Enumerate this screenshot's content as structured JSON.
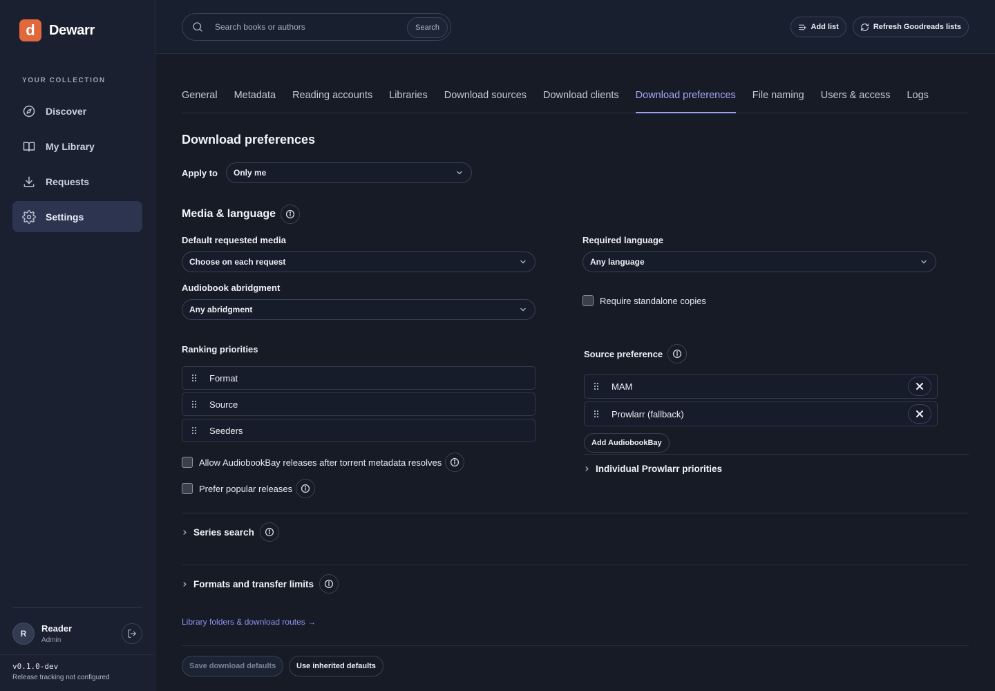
{
  "app": {
    "logo_letter": "d",
    "name": "Dewarr",
    "accent": "#a6a9f5",
    "brand": "#e0683a"
  },
  "sidebar": {
    "section_label": "YOUR COLLECTION",
    "items": [
      {
        "label": "Discover",
        "icon": "compass-icon"
      },
      {
        "label": "My Library",
        "icon": "book-icon"
      },
      {
        "label": "Requests",
        "icon": "download-icon"
      },
      {
        "label": "Settings",
        "icon": "gear-icon",
        "active": true
      }
    ],
    "user": {
      "initial": "R",
      "name": "Reader",
      "role": "Admin"
    },
    "version": "v0.1.0-dev",
    "release_status": "Release tracking not configured"
  },
  "topbar": {
    "search_placeholder": "Search books or authors",
    "search_button": "Search",
    "add_list": "Add list",
    "refresh": "Refresh Goodreads lists"
  },
  "tabs": [
    "General",
    "Metadata",
    "Reading accounts",
    "Libraries",
    "Download sources",
    "Download clients",
    "Download preferences",
    "File naming",
    "Users & access",
    "Logs"
  ],
  "active_tab": "Download preferences",
  "page": {
    "title": "Download preferences",
    "apply_to_label": "Apply to",
    "apply_to_value": "Only me",
    "media_section": "Media & language",
    "default_media_label": "Default requested media",
    "default_media_value": "Choose on each request",
    "abridgment_label": "Audiobook abridgment",
    "abridgment_value": "Any abridgment",
    "language_label": "Required language",
    "language_value": "Any language",
    "standalone_label": "Require standalone copies",
    "ranking_label": "Ranking priorities",
    "ranking": [
      "Format",
      "Source",
      "Seeders"
    ],
    "allow_abb_label": "Allow AudiobookBay releases after torrent metadata resolves",
    "prefer_popular_label": "Prefer popular releases",
    "source_pref_label": "Source preference",
    "sources": [
      "MAM",
      "Prowlarr (fallback)"
    ],
    "add_abb": "Add AudiobookBay",
    "prowlarr_priorities": "Individual Prowlarr priorities",
    "series_search": "Series search",
    "formats_limits": "Formats and transfer limits",
    "library_link": "Library folders & download routes →",
    "save_btn": "Save download defaults",
    "inherit_btn": "Use inherited defaults"
  }
}
